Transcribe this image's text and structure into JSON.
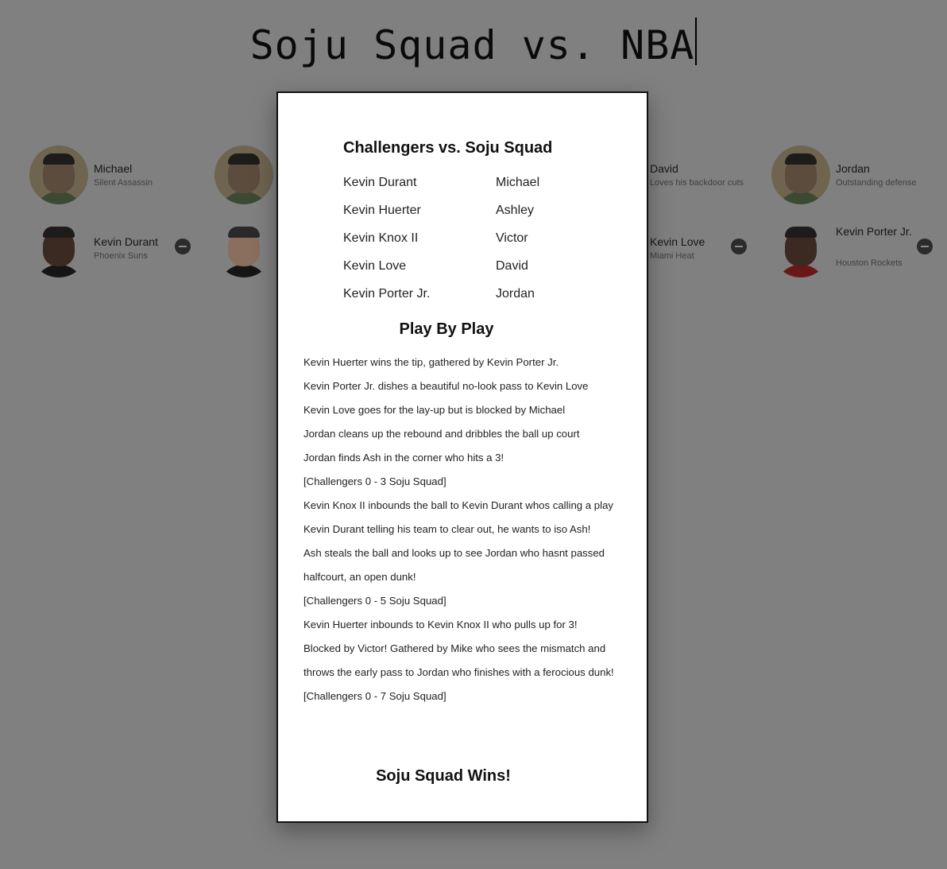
{
  "page": {
    "title": "Soju Squad vs. NBA"
  },
  "squad": [
    {
      "name": "Michael",
      "subtitle": "Silent Assassin",
      "avatar_icon": "person-photo"
    },
    {
      "name": "",
      "subtitle": "",
      "avatar_icon": "person-photo"
    },
    {
      "name": "David",
      "subtitle": "Loves his backdoor cuts",
      "avatar_icon": "person-photo"
    },
    {
      "name": "Jordan",
      "subtitle": "Outstanding defense",
      "avatar_icon": "person-photo"
    }
  ],
  "nba": [
    {
      "name": "Kevin Durant",
      "subtitle": "Phoenix Suns",
      "remove_icon": "minus-circle-icon"
    },
    {
      "name": "",
      "subtitle": "",
      "remove_icon": "minus-circle-icon"
    },
    {
      "name": "Kevin Love",
      "subtitle": "Miami Heat",
      "remove_icon": "minus-circle-icon"
    },
    {
      "name": "Kevin Porter Jr.",
      "subtitle": "Houston Rockets",
      "remove_icon": "minus-circle-icon"
    }
  ],
  "modal": {
    "title": "Challengers vs. Soju Squad",
    "roster": [
      {
        "challenger": "Kevin Durant",
        "squad": "Michael"
      },
      {
        "challenger": "Kevin Huerter",
        "squad": "Ashley"
      },
      {
        "challenger": "Kevin Knox II",
        "squad": "Victor"
      },
      {
        "challenger": "Kevin Love",
        "squad": "David"
      },
      {
        "challenger": "Kevin Porter Jr.",
        "squad": "Jordan"
      }
    ],
    "pbp_title": "Play By Play",
    "plays": [
      "Kevin Huerter wins the tip, gathered by Kevin Porter Jr.",
      "Kevin Porter Jr. dishes a beautiful no-look pass to Kevin Love",
      "Kevin Love goes for the lay-up but is blocked by Michael",
      "Jordan cleans up the rebound and dribbles the ball up court",
      "Jordan finds Ash in the corner who hits a 3!",
      "[Challengers 0 - 3 Soju Squad]",
      "Kevin Knox II inbounds the ball to Kevin Durant whos calling a play",
      "Kevin Durant telling his team to clear out, he wants to iso Ash!",
      "Ash steals the ball and looks up to see Jordan who hasnt passed halfcourt, an open dunk!",
      "[Challengers 0 - 5 Soju Squad]",
      "Kevin Huerter inbounds to Kevin Knox II who pulls up for 3!",
      "Blocked by Victor! Gathered by Mike who sees the mismatch and throws the early pass to Jordan who finishes with a ferocious dunk!",
      "[Challengers 0 - 7 Soju Squad]"
    ],
    "result": "Soju Squad Wins!"
  }
}
